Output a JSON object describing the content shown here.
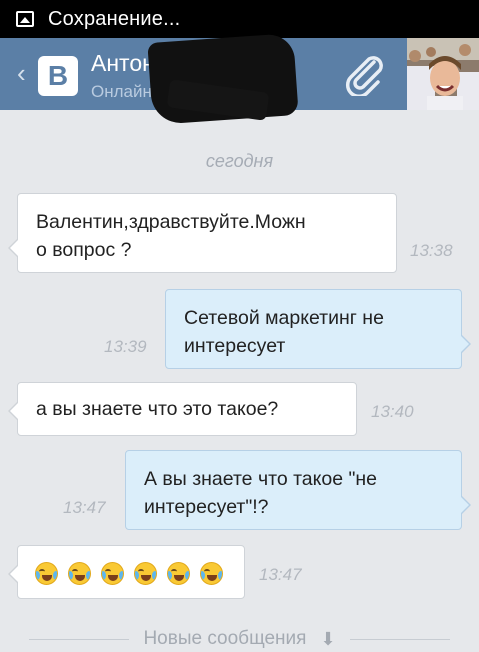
{
  "status_bar": {
    "text": "Сохранение...",
    "icon": "image-icon"
  },
  "header": {
    "back_icon": "chevron-left-icon",
    "logo_text": "B",
    "contact_name": "Антон",
    "contact_status": "Онлайн",
    "attach_icon": "paperclip-icon",
    "bg_color": "#5b7fa6"
  },
  "chat": {
    "date_label": "сегодня",
    "messages": [
      {
        "direction": "in",
        "text": "Валентин,здравствуйте.Можн\nо вопрос ?",
        "time": "13:38"
      },
      {
        "direction": "out",
        "text": "Сетевой маркетинг не\nинтересует",
        "time": "13:39"
      },
      {
        "direction": "in",
        "text": "а вы знаете что это такое?",
        "time": "13:40"
      },
      {
        "direction": "out",
        "text": "А вы знаете что такое \"не\nинтересует\"!?",
        "time": "13:47"
      },
      {
        "direction": "in",
        "emoji": "face-with-tears-of-joy",
        "emoji_count": 6,
        "time": "13:47"
      }
    ],
    "new_messages_label": "Новые сообщения",
    "new_messages_icon": "arrow-down-icon"
  },
  "colors": {
    "incoming_bubble": "#ffffff",
    "outgoing_bubble": "#dbeefa",
    "background": "#e6e8eb"
  }
}
